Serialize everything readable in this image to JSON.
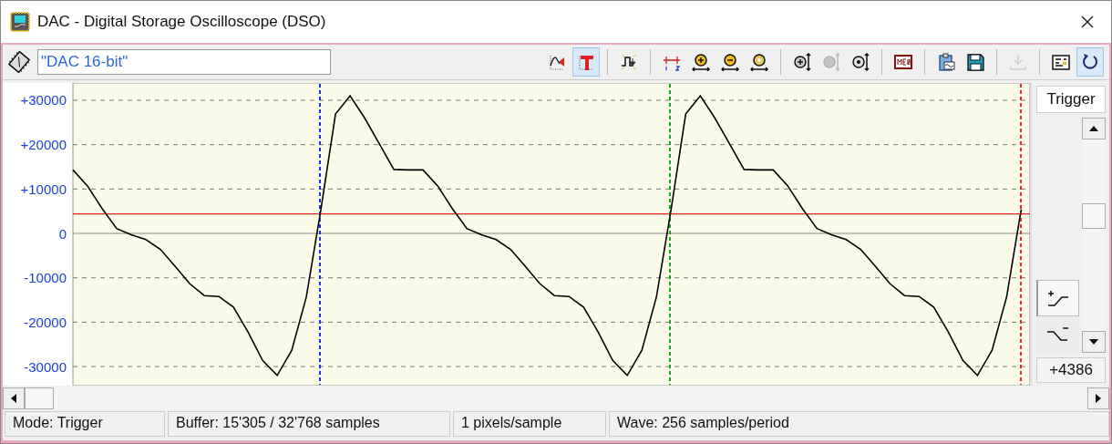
{
  "window": {
    "title": "DAC - Digital Storage Oscilloscope (DSO)"
  },
  "toolbar": {
    "channel_name": "\"DAC 16-bit\"",
    "groups": [
      [
        {
          "selected": false,
          "disabled": false
        },
        {
          "selected": true,
          "disabled": false
        }
      ],
      [
        {
          "selected": false,
          "disabled": false
        }
      ],
      [
        {
          "selected": false,
          "disabled": false
        },
        {
          "selected": false,
          "disabled": false
        },
        {
          "selected": false,
          "disabled": false
        },
        {
          "selected": false,
          "disabled": false
        }
      ],
      [
        {
          "selected": false,
          "disabled": false
        },
        {
          "selected": false,
          "disabled": true
        },
        {
          "selected": false,
          "disabled": false
        }
      ],
      [
        {
          "selected": false,
          "disabled": false
        }
      ],
      [
        {
          "selected": false,
          "disabled": false
        },
        {
          "selected": false,
          "disabled": false
        }
      ],
      [
        {
          "selected": false,
          "disabled": true
        }
      ],
      [
        {
          "selected": false,
          "disabled": false
        },
        {
          "selected": true,
          "disabled": false
        }
      ]
    ]
  },
  "scope": {
    "chart_data": {
      "type": "line",
      "grid": true,
      "ylim": [
        -34300,
        33900
      ],
      "yticks": [
        {
          "value": 30000,
          "label": "+30000"
        },
        {
          "value": 20000,
          "label": "+20000"
        },
        {
          "value": 10000,
          "label": "+10000"
        },
        {
          "value": 0,
          "label": "0"
        },
        {
          "value": -10000,
          "label": "-10000"
        },
        {
          "value": -20000,
          "label": "-20000"
        },
        {
          "value": -30000,
          "label": "-30000"
        }
      ],
      "categories": [
        null,
        null,
        null,
        null,
        null,
        null,
        null,
        null,
        null,
        null,
        null,
        null,
        null,
        null,
        null,
        null,
        null,
        null,
        null,
        null,
        null,
        null,
        null,
        null,
        null,
        null,
        null,
        null,
        null,
        null,
        null,
        null,
        null,
        null,
        null,
        null,
        null,
        null,
        null,
        null,
        null,
        null,
        null,
        null,
        null,
        null,
        null,
        null,
        null,
        null,
        null,
        null,
        null,
        null,
        null,
        null,
        null,
        null,
        null,
        null,
        null,
        null,
        null,
        null,
        null,
        null
      ],
      "series": [
        {
          "color": "#000000",
          "values": [
            14300,
            10700,
            5600,
            1100,
            -300,
            -1400,
            -3600,
            -7400,
            -11300,
            -14000,
            -14200,
            -16600,
            -22200,
            -28600,
            -32000,
            -26300,
            -14300,
            5400,
            26900,
            31000,
            26000,
            20200,
            14400,
            14300,
            14300,
            10700,
            5600,
            1100,
            -300,
            -1400,
            -3600,
            -7400,
            -11300,
            -14000,
            -14200,
            -16600,
            -22200,
            -28600,
            -32000,
            -26300,
            -14300,
            5400,
            26900,
            31000,
            26000,
            20200,
            14400,
            14300,
            14300,
            10700,
            5600,
            1100,
            -300,
            -1400,
            -3600,
            -7400,
            -11300,
            -14000,
            -14200,
            -16600,
            -22200,
            -28600,
            -32000,
            -26300,
            -14300,
            5400
          ]
        }
      ],
      "ref_lines": [
        {
          "axis": "y",
          "value": 4386,
          "color": "#e02020"
        }
      ]
    },
    "cursors": [
      {
        "color": "#2030e0"
      },
      {
        "color": "#20a020"
      },
      {
        "color": "#ff2020"
      }
    ]
  },
  "trigger_panel": {
    "title": "Trigger",
    "slopes": [
      {
        "kind": "rising",
        "selected": true
      },
      {
        "kind": "falling",
        "selected": false
      }
    ],
    "level": "+4386"
  },
  "status_bar": [
    "Mode: Trigger",
    "Buffer:  15'305 / 32'768 samples",
    "1 pixels/sample",
    "Wave: 256 samples/period"
  ]
}
